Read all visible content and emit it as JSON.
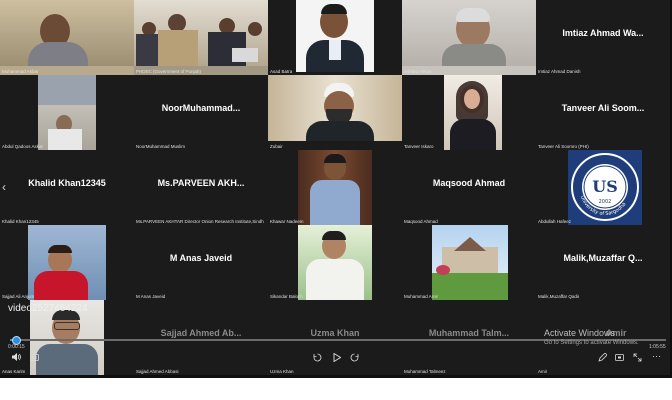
{
  "participants": [
    {
      "id": "muhammad-akbar",
      "display": "Muhammad Akbar"
    },
    {
      "id": "phdec",
      "display": "PHDEC (Government of Punjab)"
    },
    {
      "id": "asad-batra",
      "display": "Asad Batra"
    },
    {
      "id": "ashfaq-askari",
      "display": "Ashfaq Askari"
    },
    {
      "id": "imtiaz",
      "display": "Imtiaz Ahmad Danish",
      "big": "Imtiaz Ahmad Wa..."
    },
    {
      "id": "abdul-qadoos",
      "display": "Abdul Qadoos Askar"
    },
    {
      "id": "noor",
      "display": "NoorMuhammad Muslim",
      "big": "NoorMuhammad..."
    },
    {
      "id": "zubair",
      "display": "Zubair"
    },
    {
      "id": "tanveer-iskaro",
      "display": "Tanveer Iskaro"
    },
    {
      "id": "tanveer-soomro",
      "display": "Tanveer Ali Soomro (PHI)",
      "big": "Tanveer Ali Soom..."
    },
    {
      "id": "khalid",
      "display": "Khalid Khan12345",
      "big": "Khalid Khan12345"
    },
    {
      "id": "parveen",
      "display": "Ms.PARVEEN AKHTAR Director Onion Research Institute,Sindh",
      "big": "Ms.PARVEEN  AKH..."
    },
    {
      "id": "khawar",
      "display": "Khawar Nadeem"
    },
    {
      "id": "maqsood",
      "display": "Maqsood Ahmad",
      "big": "Maqsood Ahmad"
    },
    {
      "id": "abdullah",
      "display": "Abdullah Hafeez"
    },
    {
      "id": "sajjad-ali",
      "display": "Sajjad Ali Anjum"
    },
    {
      "id": "anas",
      "display": "M Anas Javeid",
      "big": "M Anas Javeid"
    },
    {
      "id": "sikandar",
      "display": "Sikandar Baloch"
    },
    {
      "id": "muhammad-amir",
      "display": "Muhammad Amir"
    },
    {
      "id": "malik",
      "display": "Malik,Muzaffar Qadir",
      "big": "Malik,Muzaffar  Q..."
    },
    {
      "id": "anas-karim",
      "display": "Anas Karim"
    },
    {
      "id": "sajjad-abbasi",
      "display": "Sajjad Ahmed Abbasi",
      "big": "Sajjad  Ahmed  Ab..."
    },
    {
      "id": "uzma",
      "display": "Uzma Khan",
      "big": "Uzma Khan"
    },
    {
      "id": "talmeez",
      "display": "Muhammad Talmeez",
      "big": "Muhammad  Talm..."
    },
    {
      "id": "amir",
      "display": "Amir",
      "big": "Amir"
    }
  ],
  "logo_text": {
    "top": "US",
    "year": "2002",
    "ring": "University of Sargodha"
  },
  "video_label": "video2527464224",
  "time_elapsed": "0:00:15",
  "time_total": "1:05:55",
  "activate": {
    "title": "Activate Windows",
    "sub": "Go to Settings to activate Windows."
  },
  "nav_prev": "‹"
}
